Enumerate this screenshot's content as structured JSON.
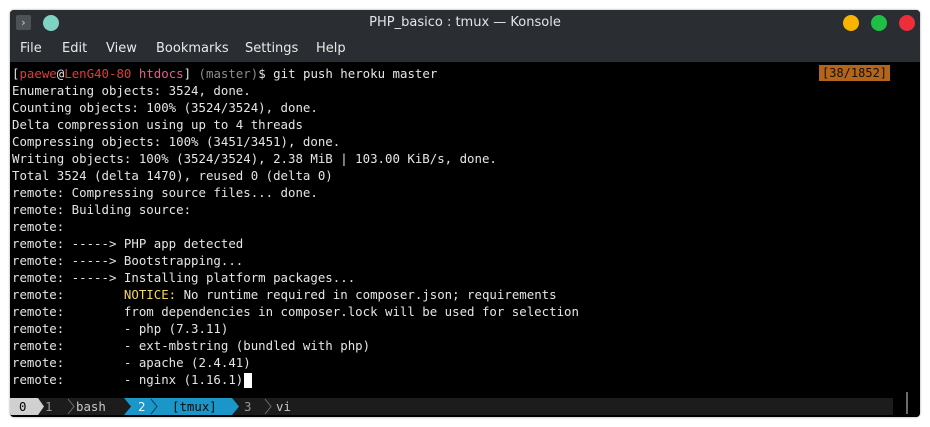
{
  "window": {
    "title": "PHP_basico : tmux — Konsole"
  },
  "menu": [
    "File",
    "Edit",
    "View",
    "Bookmarks",
    "Settings",
    "Help"
  ],
  "prompt": {
    "open": "[",
    "user": "paewe",
    "at": "@",
    "host": "LenG40-80",
    "dir": "htdocs",
    "close": "]",
    "branch": " (master)",
    "symbol": "$",
    "command": " git push heroku master"
  },
  "counter": "[38/1852]",
  "output": [
    "Enumerating objects: 3524, done.",
    "Counting objects: 100% (3524/3524), done.",
    "Delta compression using up to 4 threads",
    "Compressing objects: 100% (3451/3451), done.",
    "Writing objects: 100% (3524/3524), 2.38 MiB | 103.00 KiB/s, done.",
    "Total 3524 (delta 1470), reused 0 (delta 0)",
    "remote: Compressing source files... done.",
    "remote: Building source:",
    "remote:",
    "remote: -----> PHP app detected",
    "remote: -----> Bootstrapping...",
    "remote: -----> Installing platform packages..."
  ],
  "notice": {
    "prefix": "remote:        ",
    "keyword": "NOTICE:",
    "text": " No runtime required in composer.json; requirements"
  },
  "output_tail": [
    "remote:        from dependencies in composer.lock will be used for selection",
    "remote:        - php (7.3.11)",
    "remote:        - ext-mbstring (bundled with php)",
    "remote:        - apache (2.4.41)"
  ],
  "last_line": "remote:        - nginx (1.16.1)",
  "tmux": {
    "session": "0",
    "windows": [
      {
        "index": "1",
        "name": "bash"
      },
      {
        "index": "2",
        "name": "[tmux]"
      },
      {
        "index": "3",
        "name": "vi"
      }
    ]
  },
  "colors": {
    "titlebar": "#2a2e32",
    "terminal_bg": "#000000",
    "prompt_user": "#e23b3b",
    "prompt_dir": "#e85d87",
    "notice": "#f2d95a",
    "counter_bg": "#b5651a",
    "tmux_active": "#1a96c8"
  }
}
